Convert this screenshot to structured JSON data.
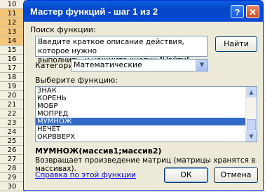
{
  "sheet": {
    "rows": [
      "10",
      "11",
      "12",
      "13",
      "14",
      "15",
      "16",
      "17",
      "18",
      "19",
      "20",
      "21",
      "22",
      "23",
      "24",
      "25",
      "26",
      "27",
      "28",
      "29",
      "30"
    ],
    "selected_rows": [
      "11",
      "12",
      "13",
      "14"
    ]
  },
  "dialog": {
    "title": "Мастер функций - шаг 1 из 2",
    "help_button": "?",
    "close_button": "✕",
    "search_label": "Поиск функции:",
    "search_value_line1": "Введите краткое описание действия, которое нужно",
    "search_value_line2": "выполнить, и нажмите кнопку \"Найти\"",
    "find_button": "Найти",
    "category_label": "Категория:",
    "category_value": "Математические",
    "select_label": "Выберите функцию:",
    "functions": [
      "ЗНАК",
      "КОРЕНЬ",
      "МОБР",
      "МОПРЕД",
      "МУМНОЖ",
      "НЕЧЁТ",
      "ОКРВВЕРХ"
    ],
    "selected_function": "МУМНОЖ",
    "signature": "МУМНОЖ(массив1;массив2)",
    "description": "Возвращает произведение матриц (матрицы хранятся в массивах).",
    "help_link": "Справка по этой функции",
    "ok_button": "ОК",
    "cancel_button": "Отмена"
  },
  "colors": {
    "titlebar": "#0a5fe0",
    "selection": "#316ac5",
    "dialog_bg": "#ece9d8",
    "link": "#0000ff"
  }
}
